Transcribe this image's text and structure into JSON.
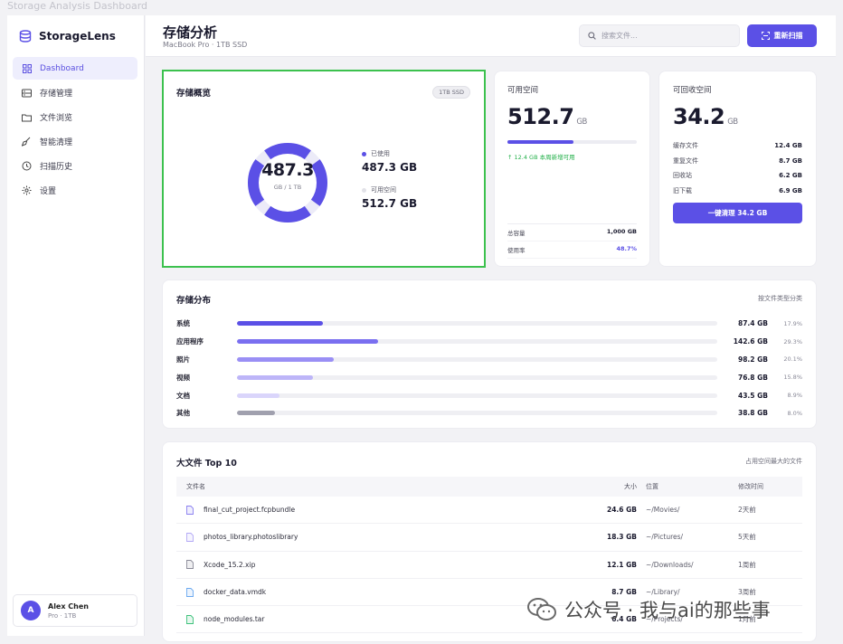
{
  "window": {
    "caption": "Storage Analysis Dashboard"
  },
  "brand": {
    "name": "StorageLens"
  },
  "sidebar": {
    "items": [
      {
        "label": "Dashboard",
        "icon": "grid-icon",
        "active": true
      },
      {
        "label": "存储管理",
        "icon": "storage-icon",
        "active": false
      },
      {
        "label": "文件浏览",
        "icon": "folder-icon",
        "active": false
      },
      {
        "label": "智能清理",
        "icon": "broom-icon",
        "active": false
      },
      {
        "label": "扫描历史",
        "icon": "clock-icon",
        "active": false
      },
      {
        "label": "设置",
        "icon": "gear-icon",
        "active": false
      }
    ],
    "user": {
      "initial": "A",
      "name": "Alex Chen",
      "plan": "Pro · 1TB"
    }
  },
  "header": {
    "title": "存储分析",
    "subtitle": "MacBook Pro · 1TB SSD",
    "search_placeholder": "搜索文件...",
    "rescan_label": "重新扫描"
  },
  "overview": {
    "title": "存储概览",
    "tag": "1TB SSD",
    "used_value": "487.3",
    "used_sub": "GB / 1 TB",
    "used_fraction": 0.487,
    "legend": [
      {
        "label": "已使用",
        "value": "487.3 GB",
        "color": "#5b50e6"
      },
      {
        "label": "可用空间",
        "value": "512.7 GB",
        "color": "#e2e2e8"
      }
    ]
  },
  "free_space": {
    "title": "可用空间",
    "value": "512.7",
    "unit": "GB",
    "bar_fraction": 0.513,
    "note": "↑ 12.4 GB 本周新增可用",
    "stats": [
      {
        "label": "总容量",
        "value": "1,000 GB",
        "accent": false
      },
      {
        "label": "使用率",
        "value": "48.7%",
        "accent": true
      }
    ]
  },
  "reclaimable": {
    "title": "可回收空间",
    "value": "34.2",
    "unit": "GB",
    "items": [
      {
        "label": "缓存文件",
        "value": "12.4 GB"
      },
      {
        "label": "重复文件",
        "value": "8.7 GB"
      },
      {
        "label": "回收站",
        "value": "6.2 GB"
      },
      {
        "label": "旧下载",
        "value": "6.9 GB"
      }
    ],
    "button_label": "一键清理 34.2 GB"
  },
  "distribution": {
    "title": "存储分布",
    "hint": "按文件类型分类",
    "rows": [
      {
        "label": "系统",
        "size": "87.4 GB",
        "pct": "17.9%",
        "percent": 17.9,
        "color": "#5b50e6"
      },
      {
        "label": "应用程序",
        "size": "142.6 GB",
        "pct": "29.3%",
        "percent": 29.3,
        "color": "#7a6ff0"
      },
      {
        "label": "照片",
        "size": "98.2 GB",
        "pct": "20.1%",
        "percent": 20.1,
        "color": "#9a8ff5"
      },
      {
        "label": "视频",
        "size": "76.8 GB",
        "pct": "15.8%",
        "percent": 15.8,
        "color": "#bdb5f8"
      },
      {
        "label": "文档",
        "size": "43.5 GB",
        "pct": "8.9%",
        "percent": 8.9,
        "color": "#dad5fb"
      },
      {
        "label": "其他",
        "size": "38.8 GB",
        "pct": "8.0%",
        "percent": 8.0,
        "color": "#a0a0ae"
      }
    ]
  },
  "top_files": {
    "title": "大文件 Top 10",
    "hint": "占用空间最大的文件",
    "columns": {
      "name": "文件名",
      "size": "大小",
      "location": "位置",
      "modified": "修改时间"
    },
    "rows": [
      {
        "name": "final_cut_project.fcpbundle",
        "size": "24.6 GB",
        "location": "~/Movies/",
        "modified": "2天前",
        "icon_color": "#8a7ff0"
      },
      {
        "name": "photos_library.photoslibrary",
        "size": "18.3 GB",
        "location": "~/Pictures/",
        "modified": "5天前",
        "icon_color": "#b3a9f6"
      },
      {
        "name": "Xcode_15.2.xip",
        "size": "12.1 GB",
        "location": "~/Downloads/",
        "modified": "1周前",
        "icon_color": "#8a8a98"
      },
      {
        "name": "docker_data.vmdk",
        "size": "8.7 GB",
        "location": "~/Library/",
        "modified": "3周前",
        "icon_color": "#6aa8f0"
      },
      {
        "name": "node_modules.tar",
        "size": "6.4 GB",
        "location": "~/Projects/",
        "modified": "1月前",
        "icon_color": "#3cc17a"
      }
    ]
  },
  "watermark": {
    "text": "公众号 · 我与ai的那些事"
  }
}
